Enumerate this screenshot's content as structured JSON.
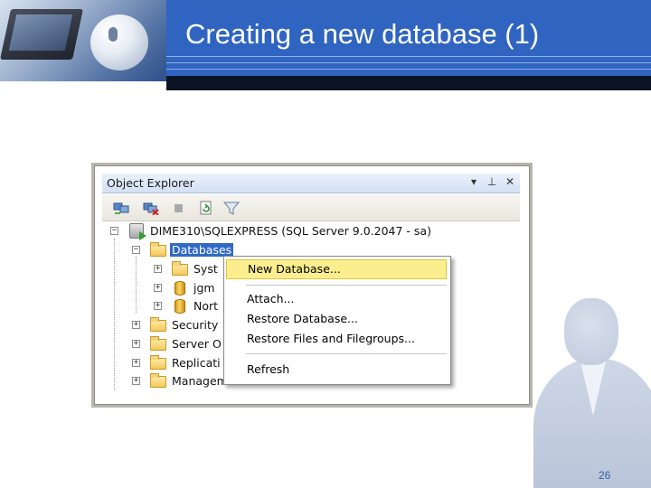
{
  "slide": {
    "title": "Creating a new database (1)",
    "page_number": "26"
  },
  "object_explorer": {
    "panel_title": "Object Explorer",
    "title_buttons": [
      "▾",
      "⊥",
      "✕"
    ],
    "toolbar_icons": [
      "connect-icon",
      "disconnect-icon",
      "stop-icon",
      "refresh-icon",
      "filter-icon"
    ],
    "tree": {
      "server": "DIME310\\SQLEXPRESS (SQL Server 9.0.2047 - sa)",
      "databases": "Databases",
      "db_children": [
        "Syst",
        "jgm",
        "Nort"
      ],
      "server_children": [
        "Security",
        "Server O",
        "Replicati",
        "Management"
      ]
    }
  },
  "context_menu": {
    "items": [
      "New Database...",
      "Attach...",
      "Restore Database...",
      "Restore Files and Filegroups...",
      "Refresh"
    ],
    "highlighted": "New Database...",
    "highlight_color": "#fbee8e"
  },
  "colors": {
    "header_blue": "#2f64c1",
    "selection_blue": "#316ac5",
    "page_number": "#3a5fa8"
  }
}
